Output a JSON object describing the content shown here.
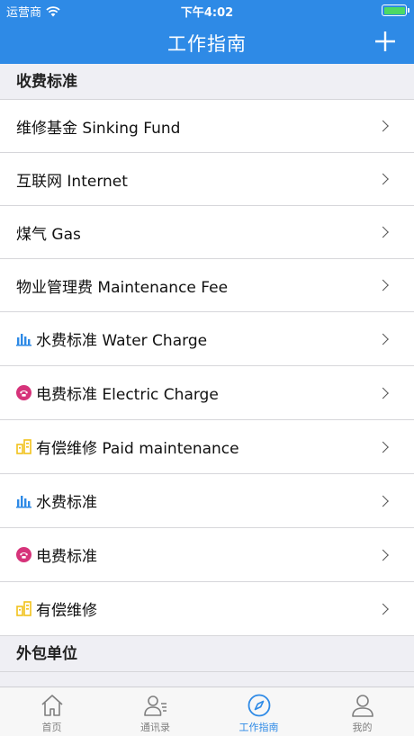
{
  "status_bar": {
    "carrier": "运营商",
    "time": "下午4:02"
  },
  "nav": {
    "title": "工作指南"
  },
  "sections": [
    {
      "header": "收费标准"
    },
    {
      "header": "外包单位"
    }
  ],
  "rows": [
    {
      "label": "维修基金 Sinking Fund",
      "icon": "none"
    },
    {
      "label": "互联网 Internet",
      "icon": "none"
    },
    {
      "label": "煤气 Gas",
      "icon": "none"
    },
    {
      "label": "物业管理费 Maintenance Fee",
      "icon": "none"
    },
    {
      "label": "水费标准 Water Charge",
      "icon": "bar-chart-icon"
    },
    {
      "label": "电费标准 Electric Charge",
      "icon": "phone-badge-icon"
    },
    {
      "label": "有偿维修 Paid maintenance",
      "icon": "building-icon"
    },
    {
      "label": "水费标准",
      "icon": "bar-chart-icon"
    },
    {
      "label": "电费标准",
      "icon": "phone-badge-icon"
    },
    {
      "label": "有偿维修",
      "icon": "building-icon"
    }
  ],
  "tabs": [
    {
      "label": "首页",
      "icon": "home-icon",
      "active": false
    },
    {
      "label": "通讯录",
      "icon": "contacts-icon",
      "active": false
    },
    {
      "label": "工作指南",
      "icon": "compass-icon",
      "active": true
    },
    {
      "label": "我的",
      "icon": "user-icon",
      "active": false
    }
  ],
  "colors": {
    "accent": "#2e8ae6",
    "bar_icon": "#2e8ae6",
    "phone_badge": "#d6337a",
    "building_icon": "#f2c21b"
  }
}
